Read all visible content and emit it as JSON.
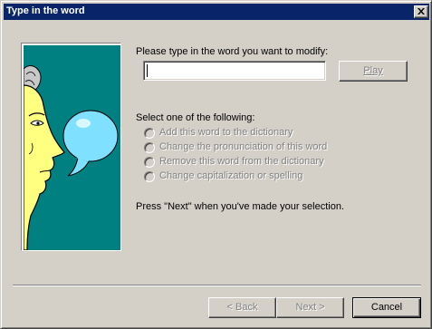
{
  "window": {
    "title": "Type in the word",
    "close_icon": "close-x-icon"
  },
  "illustration": {
    "icon": "speaking-face-icon",
    "background_color": "#008080",
    "face_color": "#ffff80",
    "bubble_color": "#80e0ff"
  },
  "form": {
    "prompt": "Please type in the word you want to modify:",
    "word_value": "",
    "play_label": "Play",
    "play_enabled": false
  },
  "options": {
    "heading": "Select one of the following:",
    "items": [
      {
        "label": "Add this word to the dictionary",
        "enabled": false,
        "selected": false
      },
      {
        "label": "Change the pronunciation of this word",
        "enabled": false,
        "selected": false
      },
      {
        "label": "Remove this word from the dictionary",
        "enabled": false,
        "selected": false
      },
      {
        "label": "Change capitalization or spelling",
        "enabled": false,
        "selected": false
      }
    ]
  },
  "hint": "Press \"Next\" when you've made your selection.",
  "footer": {
    "back_label": "< Back",
    "next_label": "Next >",
    "cancel_label": "Cancel"
  },
  "colors": {
    "title_bar": "#0a246a",
    "dialog_face": "#d4d0c8",
    "disabled_text": "#808080"
  }
}
